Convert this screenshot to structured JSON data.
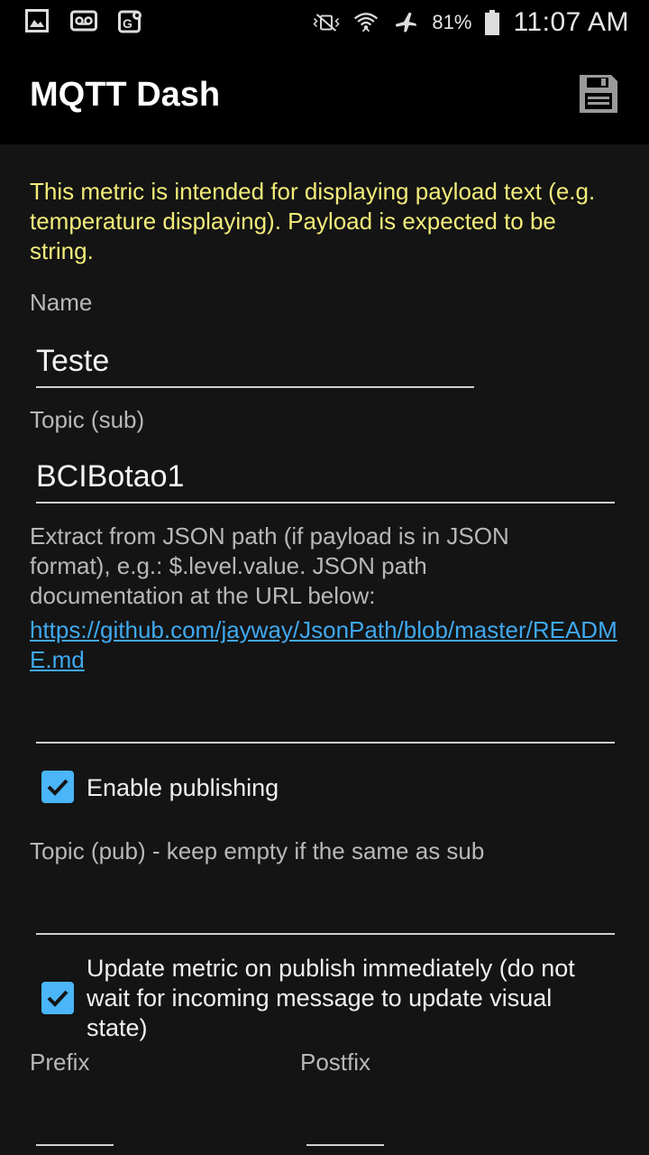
{
  "status_bar": {
    "battery": "81%",
    "time": "11:07 AM",
    "icons_left": [
      "image-icon",
      "voicemail-icon",
      "maps-icon"
    ],
    "icons_right": [
      "vibrate-icon",
      "wifi-icon",
      "airplane-icon",
      "battery-icon"
    ]
  },
  "app_bar": {
    "title": "MQTT Dash",
    "save_icon": "save-icon"
  },
  "form": {
    "info": "This metric is intended for displaying payload text (e.g. temperature displaying). Payload is expected to be string.",
    "name_label": "Name",
    "name_value": "Teste",
    "topic_sub_label": "Topic (sub)",
    "topic_sub_value": "BCIBotao1",
    "json_help": "Extract from JSON path (if payload is in JSON format), e.g.: $.level.value. JSON path documentation at the URL below:",
    "json_link": "https://github.com/jayway/JsonPath/blob/master/README.md",
    "json_path_value": "",
    "enable_publishing_label": "Enable publishing",
    "enable_publishing_checked": true,
    "topic_pub_label": "Topic (pub) - keep empty if the same as sub",
    "topic_pub_value": "",
    "update_metric_label": "Update metric on publish immediately (do not wait for incoming message to update visual state)",
    "update_metric_checked": true,
    "prefix_label": "Prefix",
    "prefix_value": "",
    "postfix_label": "Postfix",
    "postfix_value": ""
  },
  "colors": {
    "info_text": "#f2ec7a",
    "accent": "#4ab6f7",
    "link": "#3fa9f0",
    "background": "#141414",
    "bar": "#000000"
  }
}
